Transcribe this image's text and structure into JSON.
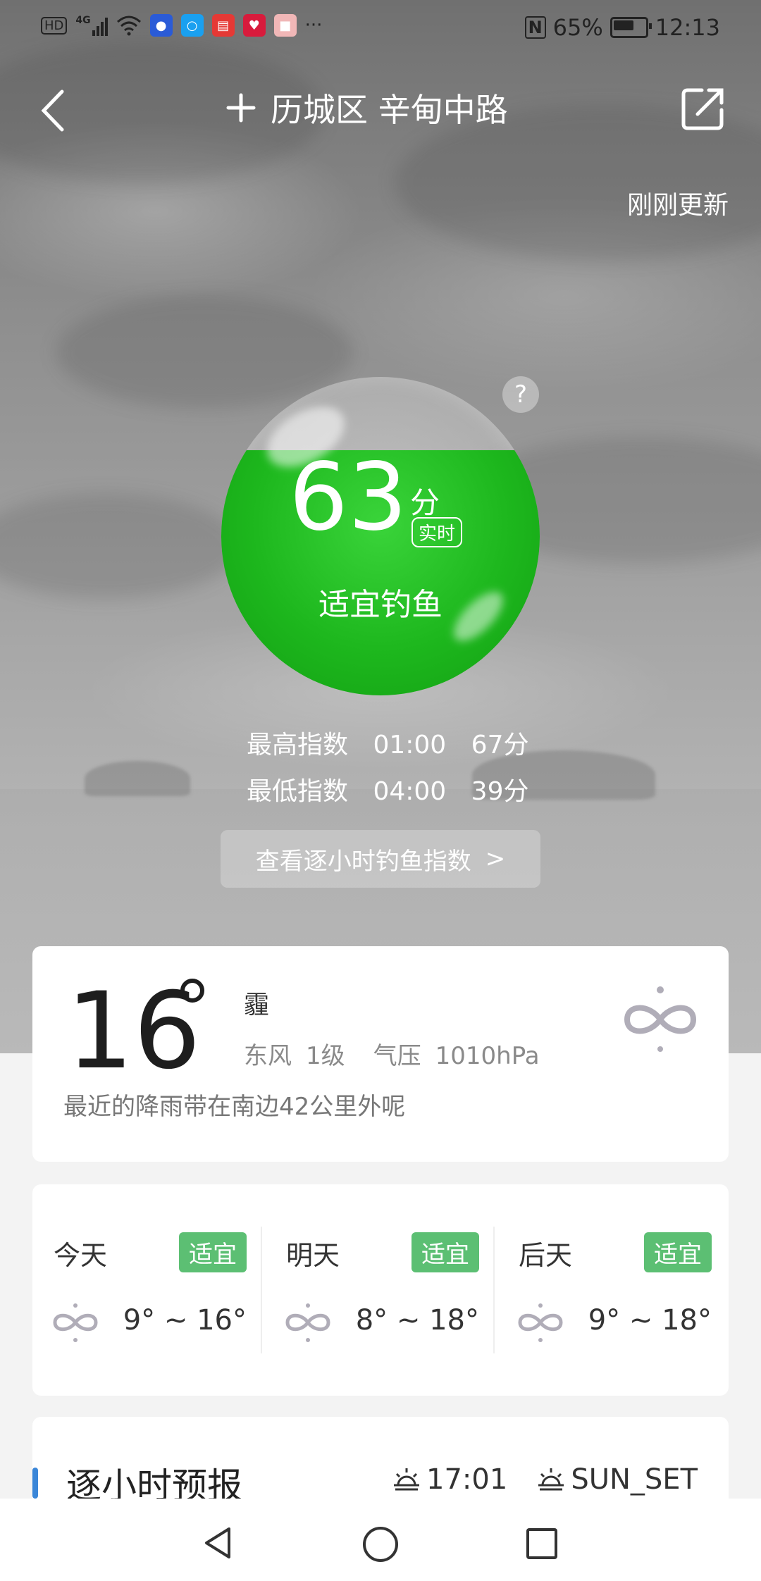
{
  "status_bar": {
    "hd": "HD",
    "network": "4G",
    "more": "···",
    "battery_percent": "65%",
    "time": "12:13",
    "icons": [
      "hd-icon",
      "signal-icon",
      "wifi-icon",
      "bulb-app-icon",
      "search-app-icon",
      "book-app-icon",
      "heart-app-icon",
      "box-app-icon",
      "nfc-icon",
      "battery-icon"
    ]
  },
  "nav": {
    "title": "历城区 辛甸中路",
    "back_icon": "chevron-left-icon",
    "add_icon": "plus-icon",
    "share_icon": "share-icon"
  },
  "update_text": "刚刚更新",
  "help_label": "?",
  "fishing": {
    "score": "63",
    "unit": "分",
    "realtime": "实时",
    "status": "适宜钓鱼",
    "level": 0.63,
    "color": "#1db71d",
    "max_label": "最高指数",
    "max_time": "01:00",
    "max_score": "67分",
    "min_label": "最低指数",
    "min_time": "04:00",
    "min_score": "39分",
    "hourly_button": "查看逐小时钓鱼指数",
    "hourly_arrow": ">"
  },
  "current": {
    "temp": "16",
    "weather": "霾",
    "wind": "东风",
    "wind_level": "1级",
    "pressure_label": "气压",
    "pressure": "1010hPa",
    "rain_note": "最近的降雨带在南边42公里外呢",
    "icon": "haze-icon"
  },
  "days": [
    {
      "name": "今天",
      "badge": "适宜",
      "range": "9° ~ 16°",
      "icon": "haze-icon"
    },
    {
      "name": "明天",
      "badge": "适宜",
      "range": "8° ~ 18°",
      "icon": "haze-icon"
    },
    {
      "name": "后天",
      "badge": "适宜",
      "range": "9° ~ 18°",
      "icon": "haze-icon"
    }
  ],
  "hourly": {
    "title": "逐小时预报",
    "sunrise_time": "17:01",
    "sunset_text": "SUN_SET"
  },
  "colors": {
    "badge": "#5cbf73",
    "accent_bar": "#3a86d8"
  }
}
